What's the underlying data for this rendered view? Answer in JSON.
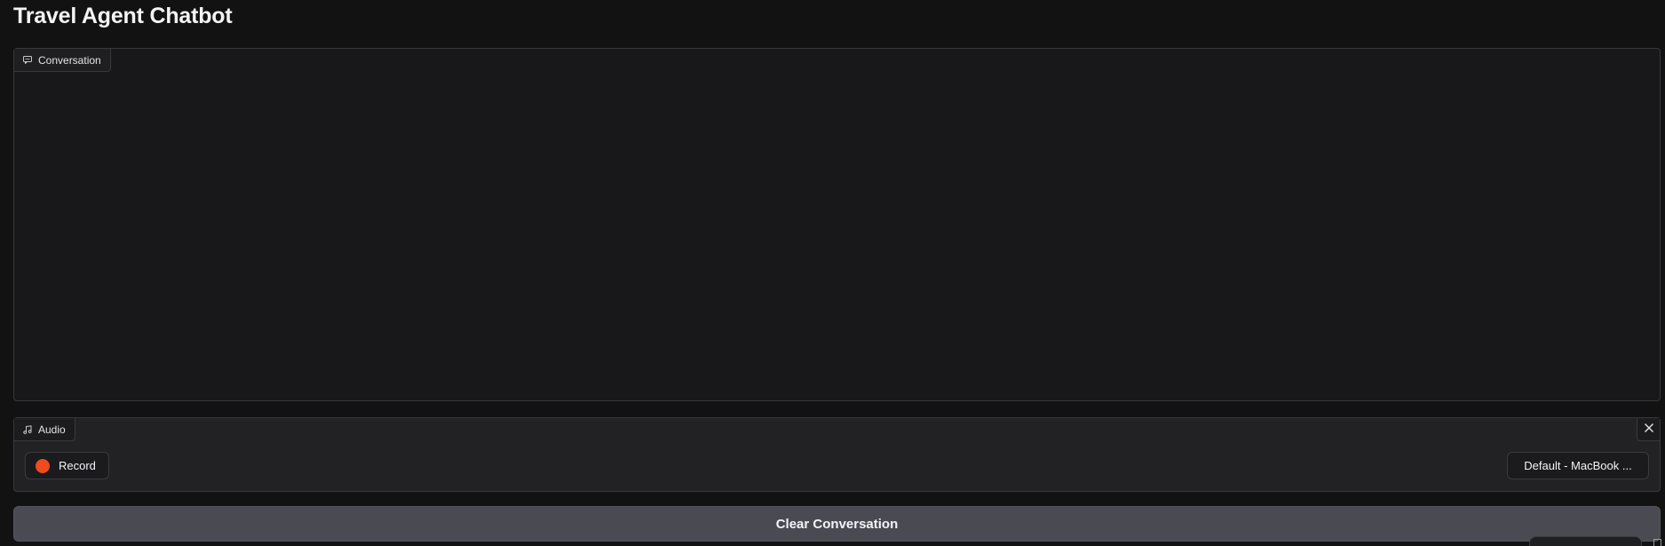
{
  "app": {
    "title": "Travel Agent Chatbot"
  },
  "chatbot": {
    "label": "Conversation",
    "icon": "chat-bubble-icon",
    "messages": []
  },
  "audio": {
    "label": "Audio",
    "icon": "music-note-icon",
    "close_icon": "close-icon",
    "record_label": "Record",
    "record_color": "#f04a1d",
    "device_selected": "Default - MacBook ..."
  },
  "actions": {
    "clear_label": "Clear Conversation"
  }
}
